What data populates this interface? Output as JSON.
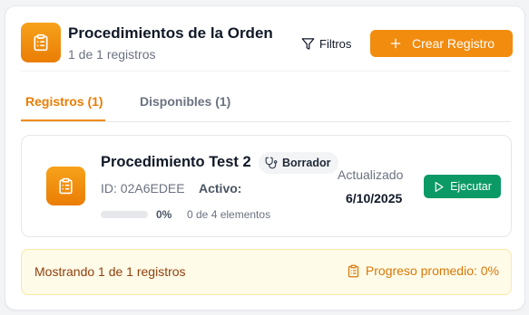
{
  "header": {
    "title": "Procedimientos de la Orden",
    "subtitle": "1 de 1 registros",
    "filters_label": "Filtros",
    "create_label": "Crear Registro"
  },
  "tabs": [
    {
      "label": "Registros (1)",
      "active": true
    },
    {
      "label": "Disponibles (1)",
      "active": false
    }
  ],
  "procedure": {
    "name": "Procedimiento Test 2",
    "status": "Borrador",
    "id_label": "ID:",
    "id_value": "02A6EDEE",
    "active_label": "Activo:",
    "progress": 0,
    "progress_text": "0%",
    "elements_text": "0 de 4 elementos",
    "updated_label": "Actualizado",
    "updated_date": "6/10/2025",
    "execute_label": "Ejecutar"
  },
  "footer": {
    "showing_text": "Mostrando 1 de 1 registros",
    "avg_progress_text": "Progreso promedio: 0%"
  },
  "colors": {
    "accent": "#f28c0f",
    "execute": "#0b9a66",
    "footer_bg": "#fefbe8"
  },
  "icons": {
    "header": "clipboard-list-icon",
    "filter": "filter-icon",
    "create": "plus-icon",
    "procedure": "clipboard-list-icon",
    "status": "stethoscope-icon",
    "execute": "play-icon",
    "footer": "clipboard-list-icon"
  }
}
